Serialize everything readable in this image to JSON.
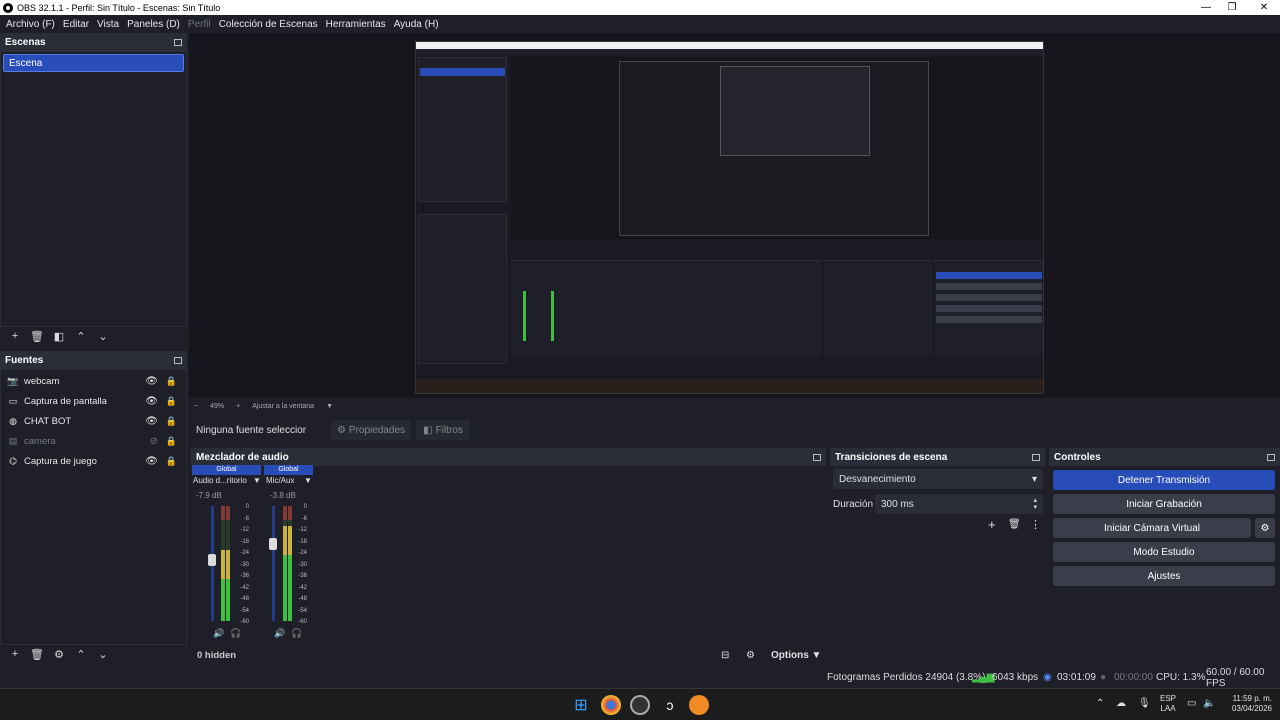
{
  "window": {
    "title": "OBS 32.1.1 - Perfil: Sin Título - Escenas: Sin Título",
    "minimize": "—",
    "maximize": "❐",
    "close": "✕"
  },
  "menu": {
    "items": [
      "Archivo (F)",
      "Editar",
      "Vista",
      "Paneles (D)",
      "Perfil",
      "Colección de Escenas",
      "Herramientas",
      "Ayuda (H)"
    ]
  },
  "scenes": {
    "title": "Escenas",
    "items": [
      "Escena"
    ]
  },
  "sources": {
    "title": "Fuentes",
    "items": [
      {
        "name": "webcam",
        "icon": "camera-icon",
        "visible": true,
        "locked": true
      },
      {
        "name": "Captura de pantalla",
        "icon": "monitor-icon",
        "visible": true,
        "locked": true
      },
      {
        "name": "CHAT BOT",
        "icon": "globe-icon",
        "visible": true,
        "locked": true
      },
      {
        "name": "camera",
        "icon": "image-icon",
        "visible": false,
        "locked": true
      },
      {
        "name": "Captura de juego",
        "icon": "gamepad-icon",
        "visible": true,
        "locked": true
      }
    ]
  },
  "zoom": {
    "minus": "−",
    "level": "49%",
    "plus": "+",
    "fit": "Ajustar a la ventana"
  },
  "context": {
    "no_source": "Ninguna fuente seleccionad",
    "properties": "Propiedades",
    "filters": "Filtros"
  },
  "mixer": {
    "title": "Mezclador de audio",
    "channels": [
      {
        "tag": "Global",
        "name": "Audio d...ritorio",
        "db": "-7.9 dB",
        "level": 0.62,
        "fader": 0.53
      },
      {
        "tag": "Global",
        "name": "Mic/Aux",
        "db": "-3.8 dB",
        "level": 0.83,
        "fader": 0.67
      }
    ],
    "scale": [
      "0",
      "-6",
      "-12",
      "-18",
      "-24",
      "-30",
      "-36",
      "-42",
      "-48",
      "-54",
      "-60"
    ],
    "hidden": "0 hidden",
    "options": "Options"
  },
  "transitions": {
    "title": "Transiciones de escena",
    "selected": "Desvanecimiento",
    "duration_label": "Duración",
    "duration_value": "300 ms"
  },
  "controls": {
    "title": "Controles",
    "stop_stream": "Detener Transmisión",
    "start_record": "Iniciar Grabación",
    "virtual_cam": "Iniciar Cámara Virtual",
    "studio_mode": "Modo Estudio",
    "settings": "Ajustes"
  },
  "status": {
    "dropped": "Fotogramas Perdidos 24904 (3.8%)",
    "bitrate": "6043 kbps",
    "stream_time": "03:01:09",
    "rec_time": "00:00:00",
    "cpu": "CPU: 1.3%",
    "fps": "60.00 / 60.00 FPS"
  },
  "taskbar": {
    "lang": "ESP",
    "region": "LAA",
    "time": "11:59 p. m.",
    "date": "03/04/2026"
  },
  "colors": {
    "accent": "#284cb8",
    "meter_green": "#3fbf3f",
    "meter_yellow": "#c8b43c",
    "meter_red": "#c83c3c"
  }
}
